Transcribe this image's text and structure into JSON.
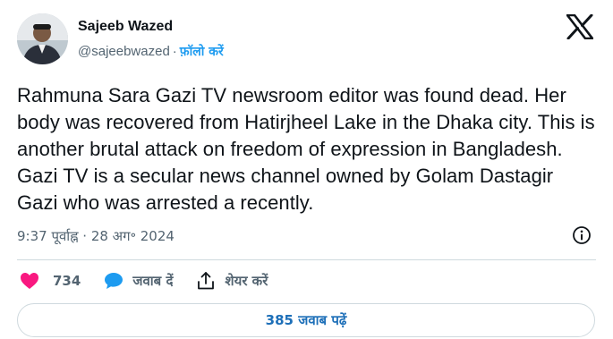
{
  "author": {
    "name": "Sajeeb Wazed",
    "handle": "@sajeebwazed",
    "separator": "·",
    "follow_label": "फ़ॉलो करें"
  },
  "tweet": {
    "text": "Rahmuna Sara Gazi TV newsroom editor was found dead. Her body was recovered from Hatirjheel Lake in the Dhaka city. This is another brutal attack on freedom of expression in Bangladesh. Gazi TV is a secular news channel owned by Golam Dastagir Gazi who was arrested a recently.",
    "timestamp": "9:37 पूर्वाह्न · 28 अग॰ 2024"
  },
  "actions": {
    "like_count": "734",
    "reply_label": "जवाब दें",
    "share_label": "शेयर करें"
  },
  "replies_button": "385 जवाब पढ़ें",
  "colors": {
    "accent": "#1d9bf0",
    "like": "#f91880",
    "text": "#0f1419",
    "muted": "#536471"
  },
  "icons": [
    "x-logo-icon",
    "info-icon",
    "heart-icon",
    "speech-bubble-icon",
    "share-icon"
  ]
}
